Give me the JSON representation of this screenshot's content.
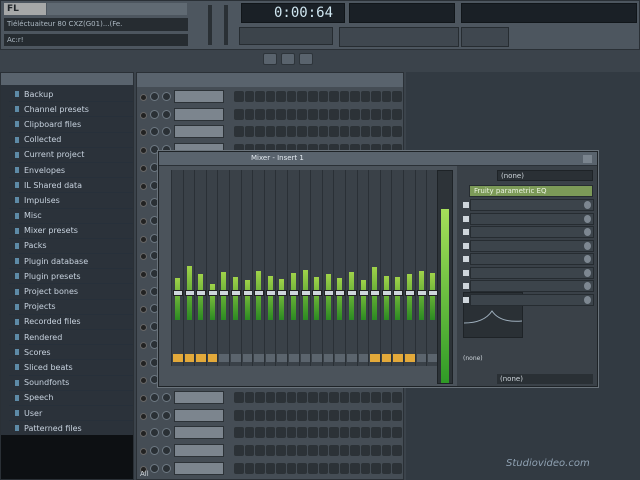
{
  "app": {
    "logo_text": "FL",
    "hint_text": "Tiéléctuaiteur 80 CXZ(G01)...(Fe.",
    "pattern_label": "Ac:r!",
    "time_display": "0:00:64"
  },
  "browser": {
    "items": [
      {
        "label": "Backup"
      },
      {
        "label": "Channel presets"
      },
      {
        "label": "Clipboard files"
      },
      {
        "label": "Collected"
      },
      {
        "label": "Current project"
      },
      {
        "label": "Envelopes"
      },
      {
        "label": "IL Shared data"
      },
      {
        "label": "Impulses"
      },
      {
        "label": "Misc"
      },
      {
        "label": "Mixer presets"
      },
      {
        "label": "Packs"
      },
      {
        "label": "Plugin database"
      },
      {
        "label": "Plugin presets"
      },
      {
        "label": "Project bones"
      },
      {
        "label": "Projects"
      },
      {
        "label": "Recorded files"
      },
      {
        "label": "Rendered"
      },
      {
        "label": "Scores"
      },
      {
        "label": "Sliced beats"
      },
      {
        "label": "Soundfonts"
      },
      {
        "label": "Speech"
      },
      {
        "label": "User"
      },
      {
        "label": "Patterned files"
      }
    ]
  },
  "mixer": {
    "title": "Mixer - Insert 1",
    "fx_header": "(none)",
    "fx_slot1": "Fruity parametric EQ",
    "out_label": "(none)",
    "in_label": "(none)",
    "levels": [
      0.35,
      0.45,
      0.38,
      0.3,
      0.4,
      0.36,
      0.33,
      0.41,
      0.37,
      0.34,
      0.39,
      0.42,
      0.36,
      0.38,
      0.35,
      0.4,
      0.33,
      0.44,
      0.37,
      0.36,
      0.38,
      0.41,
      0.39
    ],
    "master_level": 0.82
  },
  "footer": {
    "watermark": "Studiovideo.com",
    "status": "All"
  }
}
